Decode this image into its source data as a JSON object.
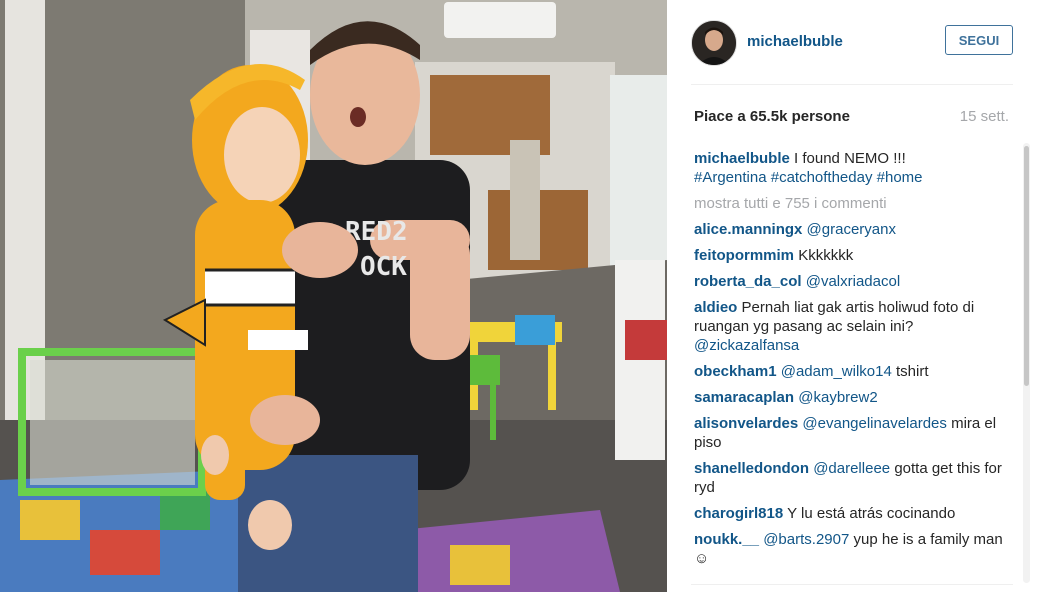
{
  "post": {
    "username": "michaelbuble",
    "follow_label": "SEGUI",
    "likes": "Piace a 65.5k persone",
    "time": "15 sett."
  },
  "caption": {
    "user": "michaelbuble",
    "text": "I found NEMO !!!",
    "hashtags": "#Argentina #catchoftheday #home"
  },
  "show_all": "mostra tutti e 755 i commenti",
  "comments": [
    {
      "user": "alice.manningx",
      "mention": "@graceryanx",
      "text": ""
    },
    {
      "user": "feitopormmim",
      "mention": "",
      "text": "Kkkkkkk"
    },
    {
      "user": "roberta_da_col",
      "mention": "@valxriadacol",
      "text": ""
    },
    {
      "user": "aldieo",
      "mention": "",
      "text": "Pernah liat gak artis holiwud foto di ruangan yg pasang ac selain ini?",
      "mention2": "@zickazalfansa"
    },
    {
      "user": "obeckham1",
      "mention": "@adam_wilko14",
      "text": "tshirt"
    },
    {
      "user": "samaracaplan",
      "mention": "@kaybrew2",
      "text": ""
    },
    {
      "user": "alisonvelardes",
      "mention": "@evangelinavelardes",
      "text": "mira el piso"
    },
    {
      "user": "shanelledondon",
      "mention": "@darelleee",
      "text": "gotta get this for ryd"
    },
    {
      "user": "charogirl818",
      "mention": "",
      "text": "Y lu está atrás cocinando"
    },
    {
      "user": "noukk.__",
      "mention": "@barts.2907",
      "text": "yup he is a family man☺"
    }
  ],
  "photo": {
    "shirt_text_1": "RED2",
    "shirt_text_2": "OCK"
  }
}
